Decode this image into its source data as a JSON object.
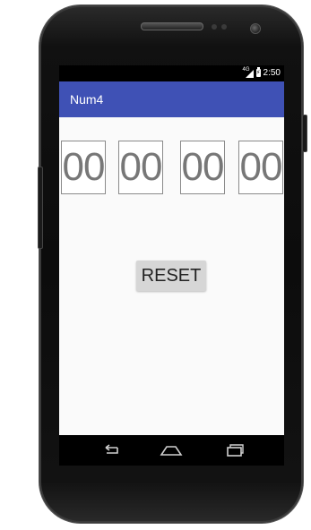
{
  "device": {
    "name": "android-phone-emulator"
  },
  "status_bar": {
    "network_label": "4G",
    "time": "2:50",
    "icons": [
      "signal-icon",
      "battery-charging-icon"
    ]
  },
  "app_bar": {
    "title": "Num4",
    "color": "#3f51b5"
  },
  "counters": [
    {
      "value": "00"
    },
    {
      "value": "00"
    },
    {
      "value": "00"
    },
    {
      "value": "00"
    }
  ],
  "reset_button": {
    "label": "RESET"
  },
  "nav_bar": {
    "icons": [
      "back-icon",
      "home-icon",
      "recents-icon"
    ]
  },
  "colors": {
    "background": "#fafafa",
    "counter_text": "#777777",
    "button_bg": "#d6d6d6"
  }
}
